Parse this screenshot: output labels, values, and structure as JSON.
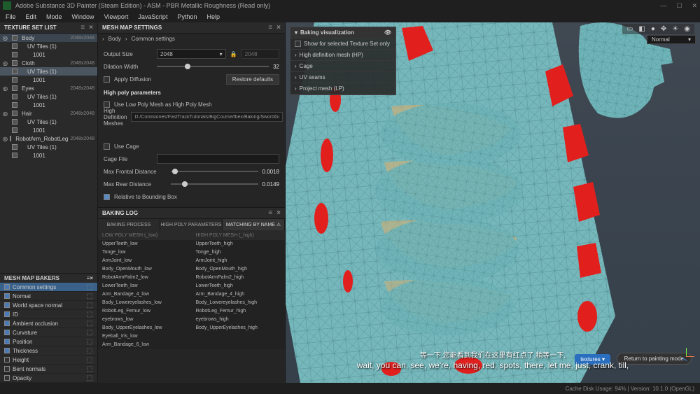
{
  "title": "Adobe Substance 3D Painter (Steam Edition) - ASM - PBR Metallic Roughness (Read only)",
  "menu": [
    "File",
    "Edit",
    "Mode",
    "Window",
    "Viewport",
    "JavaScript",
    "Python",
    "Help"
  ],
  "textureSetList": {
    "title": "TEXTURE SET LIST",
    "items": [
      {
        "eye": "◎",
        "ck": true,
        "label": "Body",
        "size": "2048x2048",
        "ind": 0,
        "hl": true
      },
      {
        "eye": "",
        "ck": true,
        "label": "UV Tiles (1)",
        "size": "",
        "ind": 1
      },
      {
        "eye": "",
        "ck": true,
        "label": "1001",
        "size": "",
        "ind": 2
      },
      {
        "eye": "◎",
        "ck": false,
        "label": "Cloth",
        "size": "2048x2048",
        "ind": 0
      },
      {
        "eye": "",
        "ck": true,
        "label": "UV Tiles (1)",
        "size": "",
        "ind": 1,
        "sel": true
      },
      {
        "eye": "",
        "ck": true,
        "label": "1001",
        "size": "",
        "ind": 2
      },
      {
        "eye": "◎",
        "ck": false,
        "label": "Eyes",
        "size": "2048x2048",
        "ind": 0
      },
      {
        "eye": "",
        "ck": true,
        "label": "UV Tiles (1)",
        "size": "",
        "ind": 1
      },
      {
        "eye": "",
        "ck": true,
        "label": "1001",
        "size": "",
        "ind": 2
      },
      {
        "eye": "◎",
        "ck": false,
        "label": "Hair",
        "size": "2048x2048",
        "ind": 0
      },
      {
        "eye": "",
        "ck": true,
        "label": "UV Tiles (1)",
        "size": "",
        "ind": 1
      },
      {
        "eye": "",
        "ck": true,
        "label": "1001",
        "size": "",
        "ind": 2
      },
      {
        "eye": "◎",
        "ck": false,
        "label": "RobotArm_RobotLeg",
        "size": "2048x2048",
        "ind": 0
      },
      {
        "eye": "",
        "ck": true,
        "label": "UV Tiles (1)",
        "size": "",
        "ind": 1
      },
      {
        "eye": "",
        "ck": true,
        "label": "1001",
        "size": "",
        "ind": 2
      }
    ]
  },
  "meshMapBakers": {
    "title": "MESH MAP BAKERS",
    "items": [
      {
        "on": true,
        "label": "Common settings",
        "sel": true
      },
      {
        "on": true,
        "label": "Normal"
      },
      {
        "on": true,
        "label": "World space normal"
      },
      {
        "on": true,
        "label": "ID"
      },
      {
        "on": true,
        "label": "Ambient occlusion"
      },
      {
        "on": true,
        "label": "Curvature"
      },
      {
        "on": true,
        "label": "Position"
      },
      {
        "on": true,
        "label": "Thickness"
      },
      {
        "on": false,
        "label": "Height"
      },
      {
        "on": false,
        "label": "Bent normals"
      },
      {
        "on": false,
        "label": "Opacity"
      }
    ]
  },
  "meshMapSettings": {
    "title": "MESH MAP SETTINGS",
    "breadcrumb": [
      "Body",
      "Common settings"
    ],
    "outputSize": {
      "label": "Output Size",
      "value": "2048",
      "locked": "2048"
    },
    "dilation": {
      "label": "Dilation Width",
      "value": "32"
    },
    "applyDiffusion": {
      "label": "Apply Diffusion"
    },
    "restoreDefaults": "Restore defaults",
    "hpParams": "High poly parameters",
    "useLowPoly": {
      "label": "Use Low Poly Mesh as High Poly Mesh"
    },
    "hdMeshes": {
      "label": "High Definition Meshes",
      "value": "D:/Comisiones/FastTrackTutorials/BigCourse/fbex/Baking/SwordGi"
    },
    "useCage": {
      "label": "Use Cage"
    },
    "cageFile": {
      "label": "Cage File"
    },
    "maxFrontal": {
      "label": "Max Frontal Distance",
      "value": "0.0018"
    },
    "maxRear": {
      "label": "Max Rear Distance",
      "value": "0.0149"
    },
    "relative": {
      "label": "Relative to Bounding Box"
    }
  },
  "bakingLog": {
    "title": "BAKING LOG",
    "tabs": [
      "BAKING PROCESS",
      "HIGH POLY PARAMETERS",
      "MATCHING BY NAME"
    ],
    "activeTab": 2,
    "cols": [
      "LOW POLY MESH (_low)",
      "HIGH POLY MESH (_high)"
    ],
    "rows": [
      [
        "UpperTeeth_low",
        "UpperTeeth_high"
      ],
      [
        "Tonge_low",
        "Tonge_high"
      ],
      [
        "ArmJoint_low",
        "ArmJoint_high"
      ],
      [
        "Body_OpenMouth_low",
        "Body_OpenMouth_high"
      ],
      [
        "RobotArmPalm2_low",
        "RobotArmPalm2_high"
      ],
      [
        "LowerTeeth_low",
        "LowerTeeth_high"
      ],
      [
        "Arm_Bandage_4_low",
        "Arm_Bandage_4_high"
      ],
      [
        "Body_Lowereyelashes_low",
        "Body_Lowereyelashes_high"
      ],
      [
        "RobotLeg_Femur_low",
        "RobotLeg_Femur_high"
      ],
      [
        "eyebrows_low",
        "eyebrows_high"
      ],
      [
        "Body_UpperEyelashes_low",
        "Body_UpperEyelashes_high"
      ],
      [
        "Eyeball_Iris_low",
        ""
      ],
      [
        "Arm_Bandage_6_low",
        ""
      ]
    ]
  },
  "overlay": {
    "title": "Baking visualization",
    "showForSelected": "Show for selected Texture Set only",
    "items": [
      "High definition mesh (HP)",
      "Cage",
      "UV seams",
      "Project mesh (LP)"
    ]
  },
  "returnBtn": "Return to painting mode",
  "texturesBtn": "textures",
  "normalMode": "Normal",
  "subtitle": {
    "cn": "等一下,您能看到我们在这里有红点了,稍等一下,",
    "en": "wait, you can, see, we're, having, red, spots, there, let me, just, crank, till,"
  },
  "status": "Cache Disk Usage:   94% | Version: 10.1.0 (OpenGL)"
}
